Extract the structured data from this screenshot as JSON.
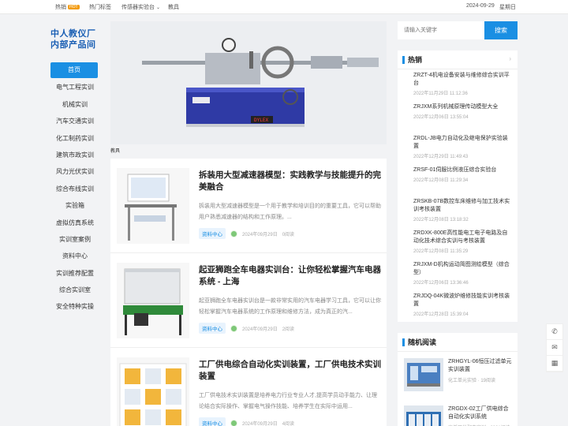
{
  "topbar": {
    "hot_label": "热销",
    "hot_badge": "HOT",
    "tags_label": "热门标签",
    "sensor_label": "传感器实验台",
    "teaching_label": "教具",
    "date": "2024-09-29",
    "weekday": "星期日"
  },
  "logo": {
    "line1": "中人教仪厂",
    "line2": "内部产品间"
  },
  "nav": {
    "items": [
      "首页",
      "电气工程实训",
      "机械实训",
      "汽车交通实训",
      "化工制药实训",
      "建筑市政实训",
      "风力光伏实训",
      "综合布线实训",
      "实验箱",
      "虚拟仿真系统",
      "实训室案例",
      "资料中心",
      "实训推荐配置",
      "综合实训室",
      "安全特种实操"
    ]
  },
  "hero": {
    "caption": "教具",
    "panel_label": "DYLEX"
  },
  "articles": [
    {
      "title": "拆装用大型减速器模型：实践教学与技能提升的完美融合",
      "excerpt": "拆装用大型减速器模型是一个用于教学和培训目的的重要工具，它可以帮助用户熟悉减速器的结构和工作原理。...",
      "tag": "资料中心",
      "date": "2024年09月29日",
      "views": "0阅读"
    },
    {
      "title": "起亚狮跑全车电器实训台：让你轻松掌握汽车电器系统 - 上海",
      "excerpt": "起亚狮跑全车电器实训台是一款非常实用的汽车电器学习工具，它可以让你轻松掌握汽车电器系统的工作原理和维修方法，成为真正的汽...",
      "tag": "资料中心",
      "date": "2024年09月29日",
      "views": "2阅读"
    },
    {
      "title": "工厂供电综合自动化实训装置，工厂供电技术实训装置",
      "excerpt": "工厂供电技术实训装置是培养电力行业专业人才,提高学员动手能力、让理论结合实际操作、掌握电气操作技能、培养学生在实际中运用...",
      "tag": "资料中心",
      "date": "2024年09月29日",
      "views": "4阅读"
    }
  ],
  "search": {
    "placeholder": "请输入关键字",
    "button": "搜索"
  },
  "hot": {
    "title": "热销",
    "items": [
      {
        "title": "ZRZT-4机电设备安装与维修综合实训平台",
        "date": "2022年11月29日 11:12:36"
      },
      {
        "title": "ZRJXM系列机械原理传动模型大全",
        "date": "2022年12月06日 13:55:04"
      },
      {
        "title": "ZRDL-JB电力自动化及继电保护实验装置",
        "date": "2022年12月29日 11:49:43"
      },
      {
        "title": "ZRSF-01伺服比例液压综合实验台",
        "date": "2022年12月08日 11:29:34"
      },
      {
        "title": "ZRSKB-07B数控车床维修与加工技术实训考核装置",
        "date": "2022年12月08日 13:18:32"
      },
      {
        "title": "ZRDXK-800E高性能电工电子电路及自动化技术综合实训与考核装置",
        "date": "2022年12月08日 11:35:29"
      },
      {
        "title": "ZRJXM-D机构运动简图测绘模型（综合型）",
        "date": "2022年12月06日 13:36:46"
      },
      {
        "title": "ZRJDQ-04K微波炉维修技能实训考核装置",
        "date": "2022年12月28日 15:39:04"
      }
    ]
  },
  "random": {
    "title": "随机阅读",
    "items": [
      {
        "title": "ZRHGYL-06恒压过滤单元实训装置",
        "meta": "化工单元实验 · 19阅读"
      },
      {
        "title": "ZRGDX-02工厂供电综合自动化实训系统",
        "meta": "高低压供配电实训 · 6881阅读"
      }
    ]
  }
}
